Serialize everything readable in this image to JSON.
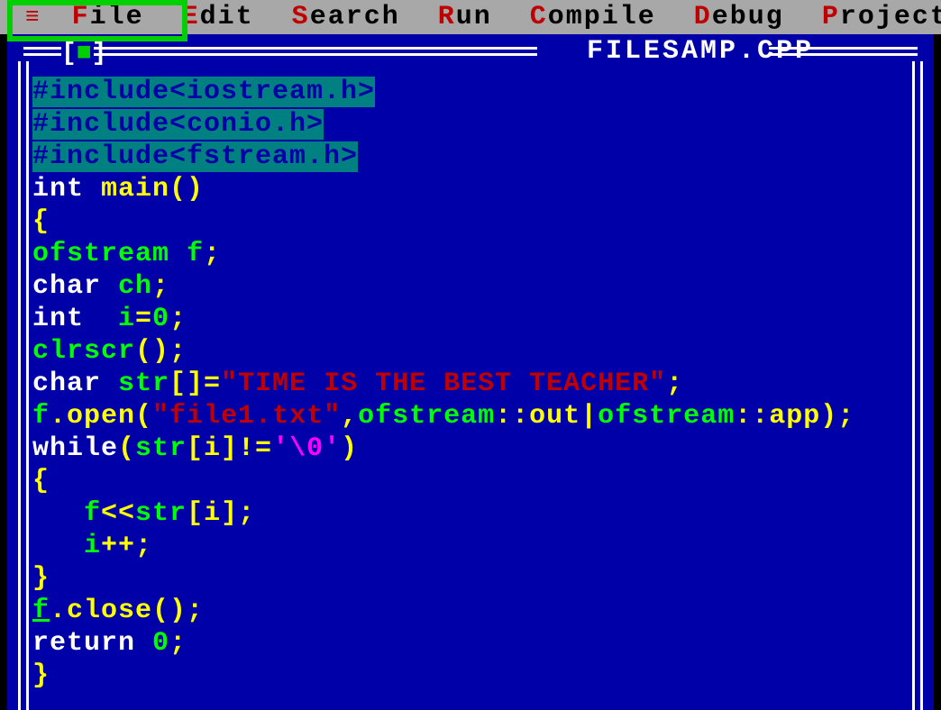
{
  "menu": {
    "hamburger": "≡",
    "items": [
      {
        "hotkey": "F",
        "rest": "ile"
      },
      {
        "hotkey": "E",
        "rest": "dit"
      },
      {
        "hotkey": "S",
        "rest": "earch"
      },
      {
        "hotkey": "R",
        "rest": "un"
      },
      {
        "hotkey": "C",
        "rest": "ompile"
      },
      {
        "hotkey": "D",
        "rest": "ebug"
      },
      {
        "hotkey": "P",
        "rest": "roject"
      }
    ]
  },
  "window": {
    "close_left": "[",
    "close_inner": "■",
    "close_right": "]",
    "title": " FILESAMP.CPP "
  },
  "code": {
    "lines": [
      [
        {
          "cls": "c-teal-bg",
          "t": "#include<iostream.h>"
        }
      ],
      [
        {
          "cls": "c-teal-bg",
          "t": "#include<conio.h>"
        }
      ],
      [
        {
          "cls": "c-teal-bg",
          "t": "#include<fstream.h>"
        }
      ],
      [
        {
          "cls": "c-white",
          "t": "int "
        },
        {
          "cls": "c-yellow",
          "t": "main()"
        }
      ],
      [
        {
          "cls": "c-yellow",
          "t": "{"
        }
      ],
      [
        {
          "cls": "c-green",
          "t": "ofstream f"
        },
        {
          "cls": "c-yellow",
          "t": ";"
        }
      ],
      [
        {
          "cls": "c-white",
          "t": "char "
        },
        {
          "cls": "c-green",
          "t": "ch"
        },
        {
          "cls": "c-yellow",
          "t": ";"
        }
      ],
      [
        {
          "cls": "c-white",
          "t": "int  "
        },
        {
          "cls": "c-green",
          "t": "i"
        },
        {
          "cls": "c-yellow",
          "t": "="
        },
        {
          "cls": "c-green",
          "t": "0"
        },
        {
          "cls": "c-yellow",
          "t": ";"
        }
      ],
      [
        {
          "cls": "c-green",
          "t": "clrscr"
        },
        {
          "cls": "c-yellow",
          "t": "();"
        }
      ],
      [
        {
          "cls": "c-white",
          "t": "char "
        },
        {
          "cls": "c-green",
          "t": "str"
        },
        {
          "cls": "c-yellow",
          "t": "[]="
        },
        {
          "cls": "c-red",
          "t": "\"TIME IS THE BEST TEACHER\""
        },
        {
          "cls": "c-yellow",
          "t": ";"
        }
      ],
      [
        {
          "cls": "c-green",
          "t": "f"
        },
        {
          "cls": "c-yellow",
          "t": ".open("
        },
        {
          "cls": "c-red",
          "t": "\"file1.txt\""
        },
        {
          "cls": "c-yellow",
          "t": ","
        },
        {
          "cls": "c-green",
          "t": "ofstream"
        },
        {
          "cls": "c-yellow",
          "t": "::out|"
        },
        {
          "cls": "c-green",
          "t": "ofstream"
        },
        {
          "cls": "c-yellow",
          "t": "::app);"
        }
      ],
      [
        {
          "cls": "c-white",
          "t": "while"
        },
        {
          "cls": "c-yellow",
          "t": "("
        },
        {
          "cls": "c-green",
          "t": "str"
        },
        {
          "cls": "c-yellow",
          "t": "[i]!="
        },
        {
          "cls": "c-magenta",
          "t": "'\\0'"
        },
        {
          "cls": "c-yellow",
          "t": ")"
        }
      ],
      [
        {
          "cls": "c-yellow",
          "t": "{"
        }
      ],
      [
        {
          "cls": "c-yellow",
          "t": "   "
        },
        {
          "cls": "c-green",
          "t": "f"
        },
        {
          "cls": "c-yellow",
          "t": "<<"
        },
        {
          "cls": "c-green",
          "t": "str"
        },
        {
          "cls": "c-yellow",
          "t": "[i];"
        }
      ],
      [
        {
          "cls": "c-yellow",
          "t": "   "
        },
        {
          "cls": "c-green",
          "t": "i"
        },
        {
          "cls": "c-yellow",
          "t": "++;"
        }
      ],
      [
        {
          "cls": "c-yellow",
          "t": "}"
        }
      ],
      [
        {
          "cls": "c-green underline",
          "t": "f"
        },
        {
          "cls": "c-yellow",
          "t": ".close();"
        }
      ],
      [
        {
          "cls": "c-white",
          "t": "return "
        },
        {
          "cls": "c-green",
          "t": "0"
        },
        {
          "cls": "c-yellow",
          "t": ";"
        }
      ],
      [
        {
          "cls": "c-yellow",
          "t": "}"
        }
      ]
    ]
  }
}
